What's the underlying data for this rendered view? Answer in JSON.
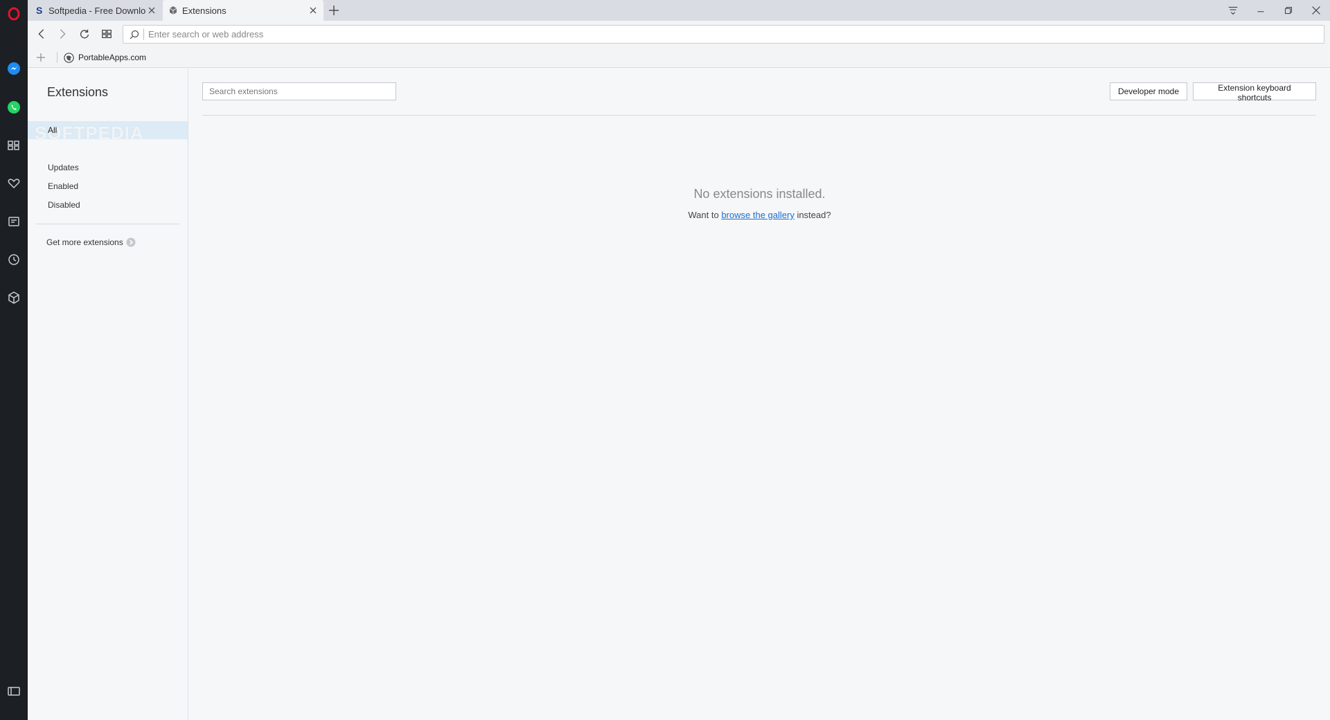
{
  "tabs": [
    {
      "title": "Softpedia - Free Downloads",
      "icon": "softpedia-s-icon"
    },
    {
      "title": "Extensions",
      "icon": "extension-cube-icon"
    }
  ],
  "address": {
    "placeholder": "Enter search or web address",
    "value": ""
  },
  "bookmarks": [
    {
      "label": "PortableApps.com",
      "icon": "globe-icon"
    }
  ],
  "ext": {
    "title": "Extensions",
    "nav": {
      "all": "All",
      "updates": "Updates",
      "enabled": "Enabled",
      "disabled": "Disabled",
      "get_more": "Get more extensions"
    },
    "search_placeholder": "Search extensions",
    "developer_mode": "Developer mode",
    "keyboard_shortcuts": "Extension keyboard shortcuts",
    "empty_title": "No extensions installed.",
    "empty_pre": "Want to ",
    "empty_link": "browse the gallery",
    "empty_post": " instead?"
  },
  "watermark": "SOFTPEDIA",
  "colors": {
    "sidebar_bg": "#1c1f24",
    "opera_red": "#e0152b",
    "messenger_blue": "#1e8cf3",
    "whatsapp_green": "#25d366",
    "nav_selected": "#dcebf5",
    "link": "#1a6ecf"
  }
}
